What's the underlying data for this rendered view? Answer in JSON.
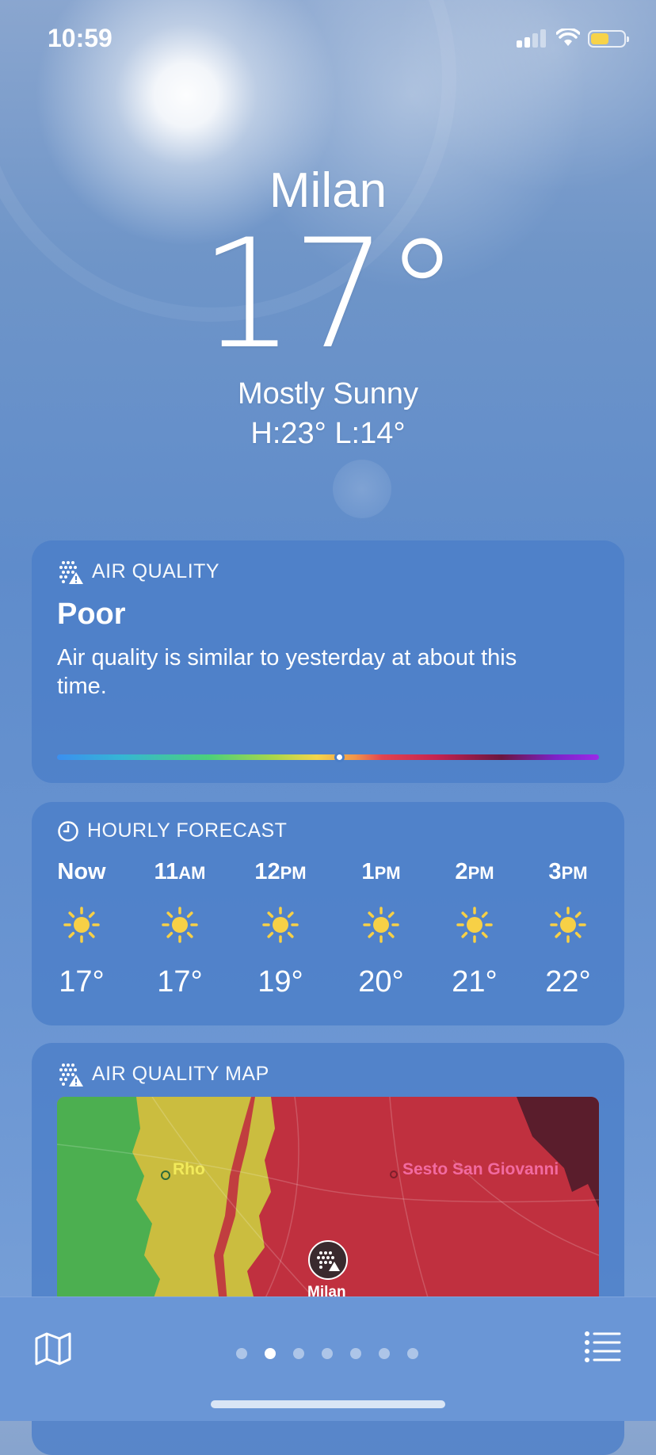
{
  "status_bar": {
    "time": "10:59"
  },
  "location": {
    "city": "Milan",
    "temperature": "17°",
    "condition": "Mostly Sunny",
    "high_low": "H:23°  L:14°"
  },
  "air_quality": {
    "title": "AIR QUALITY",
    "level": "Poor",
    "description": "Air quality is similar to yesterday at about this time.",
    "indicator_position": 0.52
  },
  "hourly": {
    "title": "HOURLY FORECAST",
    "hours": [
      {
        "time": "Now",
        "suffix": "",
        "icon": "sun-icon",
        "temp": "17°"
      },
      {
        "time": "11",
        "suffix": "AM",
        "icon": "sun-icon",
        "temp": "17°"
      },
      {
        "time": "12",
        "suffix": "PM",
        "icon": "sun-icon",
        "temp": "19°"
      },
      {
        "time": "1",
        "suffix": "PM",
        "icon": "sun-icon",
        "temp": "20°"
      },
      {
        "time": "2",
        "suffix": "PM",
        "icon": "sun-icon",
        "temp": "21°"
      },
      {
        "time": "3",
        "suffix": "PM",
        "icon": "sun-icon",
        "temp": "22°"
      }
    ]
  },
  "air_quality_map": {
    "title": "AIR QUALITY MAP",
    "labels": {
      "rho": "Rho",
      "sesto": "Sesto San Giovanni",
      "milan": "Milan"
    }
  },
  "bottom_bar": {
    "page_count": 7,
    "active_page": 1
  },
  "colors": {
    "sun": "#f7d046",
    "battery": "#f7d34a",
    "aq_poor": "#c0303f"
  }
}
